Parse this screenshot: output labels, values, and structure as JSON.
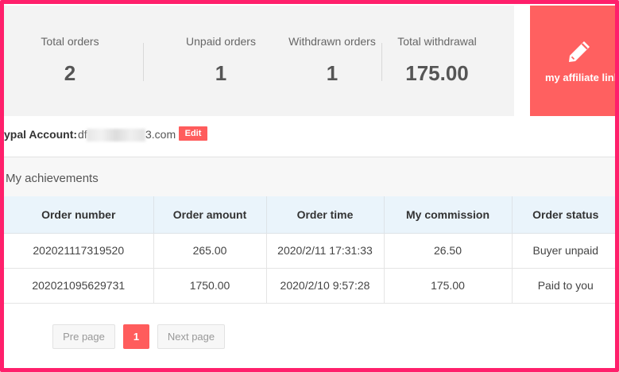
{
  "stats": [
    {
      "label": "Total orders",
      "value": "2"
    },
    {
      "label": "Unpaid orders",
      "value": "1"
    },
    {
      "label": "Withdrawn orders",
      "value": "1"
    },
    {
      "label": "Total withdrawal",
      "value": "175.00"
    }
  ],
  "affiliate": {
    "label": "my affiliate link",
    "icon": "pencil-icon"
  },
  "paypal": {
    "label": "ypal Account:",
    "value_prefix": "df",
    "value_suffix": "3.com",
    "edit_label": "Edit"
  },
  "achievements": {
    "title": "My achievements"
  },
  "table": {
    "headers": [
      "Order number",
      "Order amount",
      "Order time",
      "My commission",
      "Order status"
    ],
    "rows": [
      [
        "202021117319520",
        "265.00",
        "2020/2/11 17:31:33",
        "26.50",
        "Buyer unpaid"
      ],
      [
        "202021095629731",
        "1750.00",
        "2020/2/10 9:57:28",
        "175.00",
        "Paid to you"
      ]
    ]
  },
  "pager": {
    "prev": "Pre page",
    "current": "1",
    "next": "Next page"
  },
  "colors": {
    "accent": "#ff5c5c",
    "frame": "#ff1f6b",
    "header_bg": "#eaf4fb",
    "stats_bg": "#f3f3f3"
  }
}
